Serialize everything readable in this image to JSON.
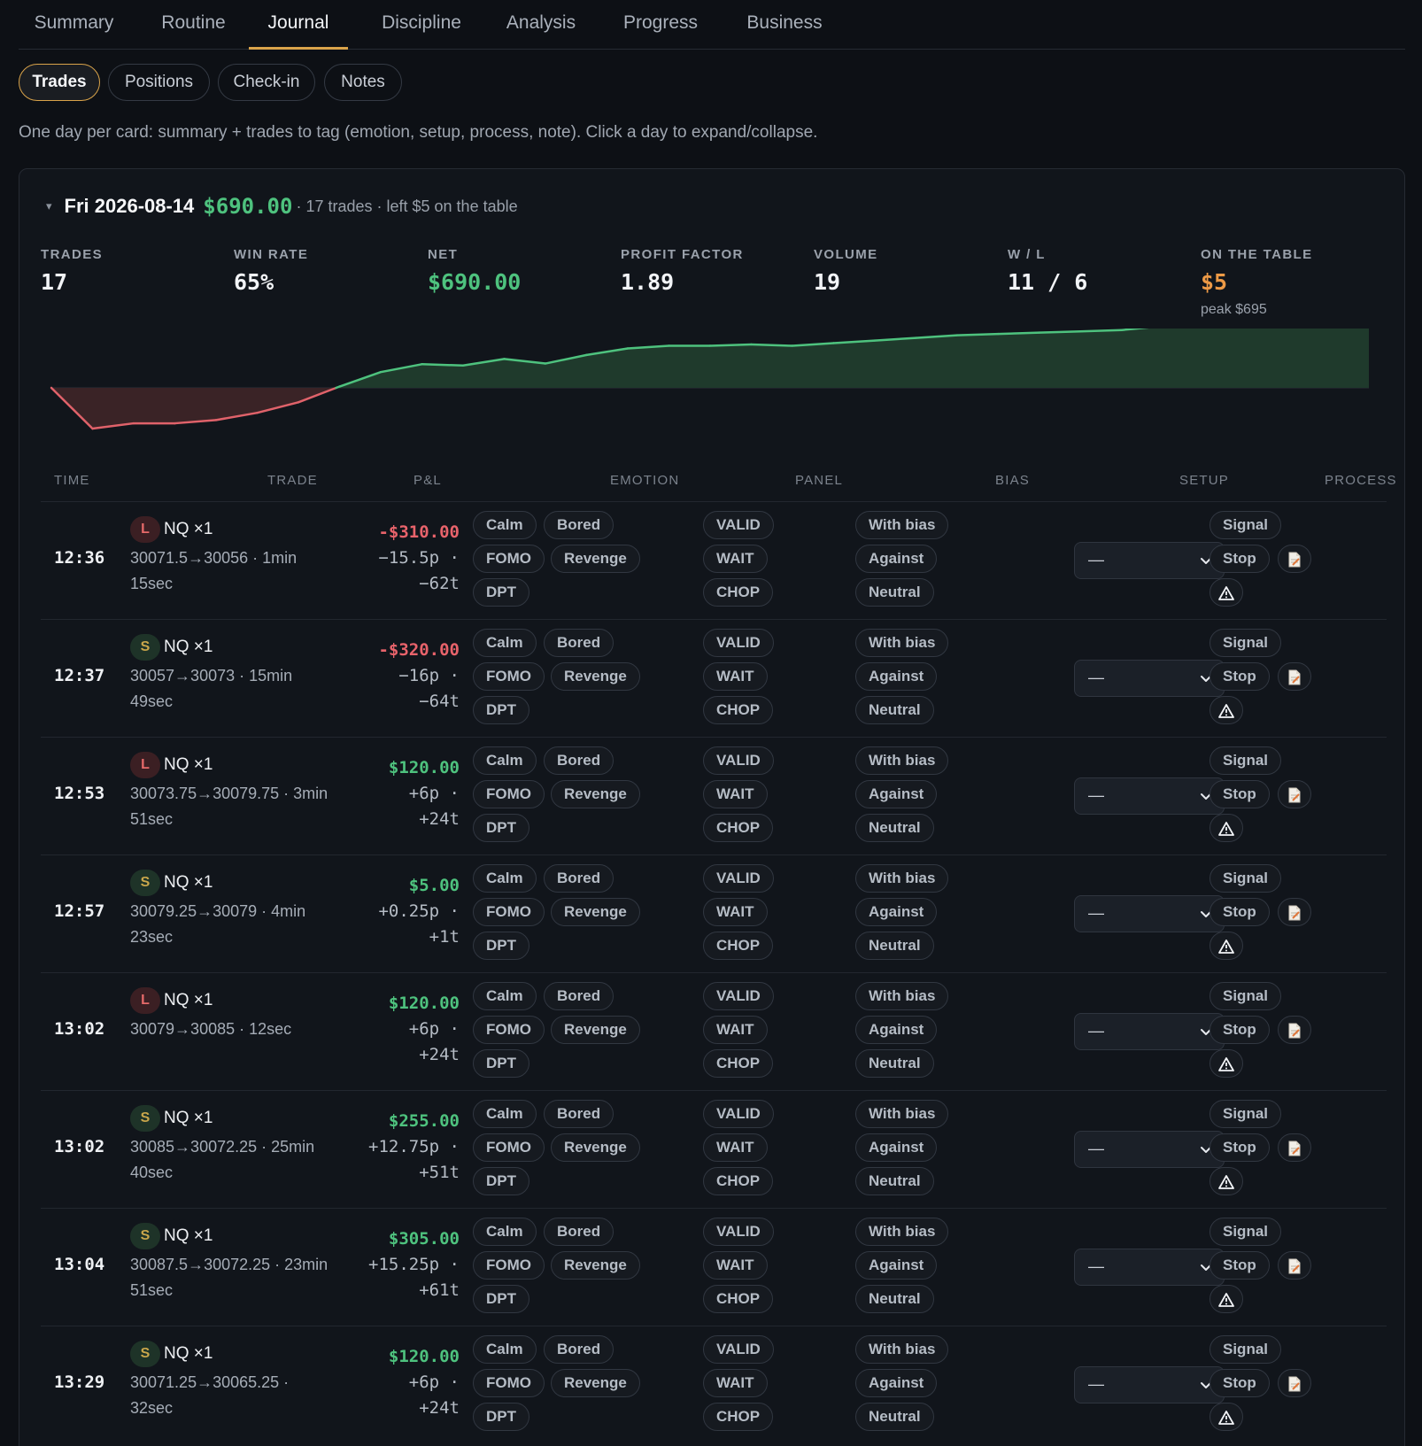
{
  "nav": {
    "tabs": [
      "Summary",
      "Routine",
      "Journal",
      "Discipline",
      "Analysis",
      "Progress",
      "Business"
    ],
    "active": "Journal"
  },
  "subtabs": {
    "items": [
      "Trades",
      "Positions",
      "Check-in",
      "Notes"
    ],
    "active": "Trades"
  },
  "hint": "One day per card: summary + trades to tag (emotion, setup, process, note). Click a day to expand/collapse.",
  "day": {
    "caret": "▾",
    "date": "Fri 2026-08-14",
    "net": "$690.00",
    "meta": "· 17 trades · left $5 on the table",
    "stats": {
      "trades": {
        "label": "TRADES",
        "value": "17"
      },
      "win_rate": {
        "label": "WIN RATE",
        "value": "65%"
      },
      "net": {
        "label": "NET",
        "value": "$690.00"
      },
      "profit_factor": {
        "label": "PROFIT FACTOR",
        "value": "1.89"
      },
      "volume": {
        "label": "VOLUME",
        "value": "19"
      },
      "wl": {
        "label": "W / L",
        "value": "11 / 6"
      },
      "on_table": {
        "label": "ON THE TABLE",
        "value": "$5",
        "sub": "peak $695"
      }
    }
  },
  "equity_curve": {
    "points": [
      0,
      -310,
      -270,
      -270,
      -245,
      -190,
      -110,
      10,
      120,
      180,
      170,
      220,
      185,
      250,
      300,
      320,
      320,
      330,
      320,
      340,
      360,
      380,
      400,
      410,
      420,
      430,
      440,
      470,
      500,
      530,
      600,
      650,
      690
    ],
    "colors": {
      "positive": "#4ec27e",
      "negative": "#e0626a"
    }
  },
  "table": {
    "headers": {
      "time": "TIME",
      "trade": "TRADE",
      "pnl": "P&L",
      "emotion": "EMOTION",
      "panel": "PANEL",
      "bias": "BIAS",
      "setup": "SETUP",
      "process": "PROCESS"
    },
    "emotion_options": [
      "Calm",
      "Bored",
      "FOMO",
      "Revenge",
      "DPT"
    ],
    "panel_options": [
      "VALID",
      "WAIT",
      "CHOP"
    ],
    "bias_options": [
      "With bias",
      "Against",
      "Neutral"
    ],
    "process_options": [
      "Signal",
      "Stop"
    ],
    "setup_placeholder": "—",
    "rows": [
      {
        "time": "12:36",
        "side": "L",
        "instrument": "NQ ×1",
        "detail": "30071.5→30056 · 1min 15sec",
        "pnl": "-$310.00",
        "sign": "neg",
        "points": "−15.5p ·",
        "ticks": "−62t"
      },
      {
        "time": "12:37",
        "side": "S",
        "instrument": "NQ ×1",
        "detail": "30057→30073 · 15min 49sec",
        "pnl": "-$320.00",
        "sign": "neg",
        "points": "−16p ·",
        "ticks": "−64t"
      },
      {
        "time": "12:53",
        "side": "L",
        "instrument": "NQ ×1",
        "detail": "30073.75→30079.75 · 3min 51sec",
        "pnl": "$120.00",
        "sign": "pos",
        "points": "+6p ·",
        "ticks": "+24t"
      },
      {
        "time": "12:57",
        "side": "S",
        "instrument": "NQ ×1",
        "detail": "30079.25→30079 · 4min 23sec",
        "pnl": "$5.00",
        "sign": "pos",
        "points": "+0.25p ·",
        "ticks": "+1t"
      },
      {
        "time": "13:02",
        "side": "L",
        "instrument": "NQ ×1",
        "detail": "30079→30085 · 12sec",
        "pnl": "$120.00",
        "sign": "pos",
        "points": "+6p ·",
        "ticks": "+24t"
      },
      {
        "time": "13:02",
        "side": "S",
        "instrument": "NQ ×1",
        "detail": "30085→30072.25 · 25min 40sec",
        "pnl": "$255.00",
        "sign": "pos",
        "points": "+12.75p ·",
        "ticks": "+51t"
      },
      {
        "time": "13:04",
        "side": "S",
        "instrument": "NQ ×1",
        "detail": "30087.5→30072.25 · 23min 51sec",
        "pnl": "$305.00",
        "sign": "pos",
        "points": "+15.25p ·",
        "ticks": "+61t"
      },
      {
        "time": "13:29",
        "side": "S",
        "instrument": "NQ ×1",
        "detail": "30071.25→30065.25 · 32sec",
        "pnl": "$120.00",
        "sign": "pos",
        "points": "+6p ·",
        "ticks": "+24t"
      }
    ]
  },
  "icons": {
    "note": "note-icon",
    "warning": "warning-icon",
    "chevron": "chevron-down-icon",
    "caret": "caret-down-icon"
  }
}
